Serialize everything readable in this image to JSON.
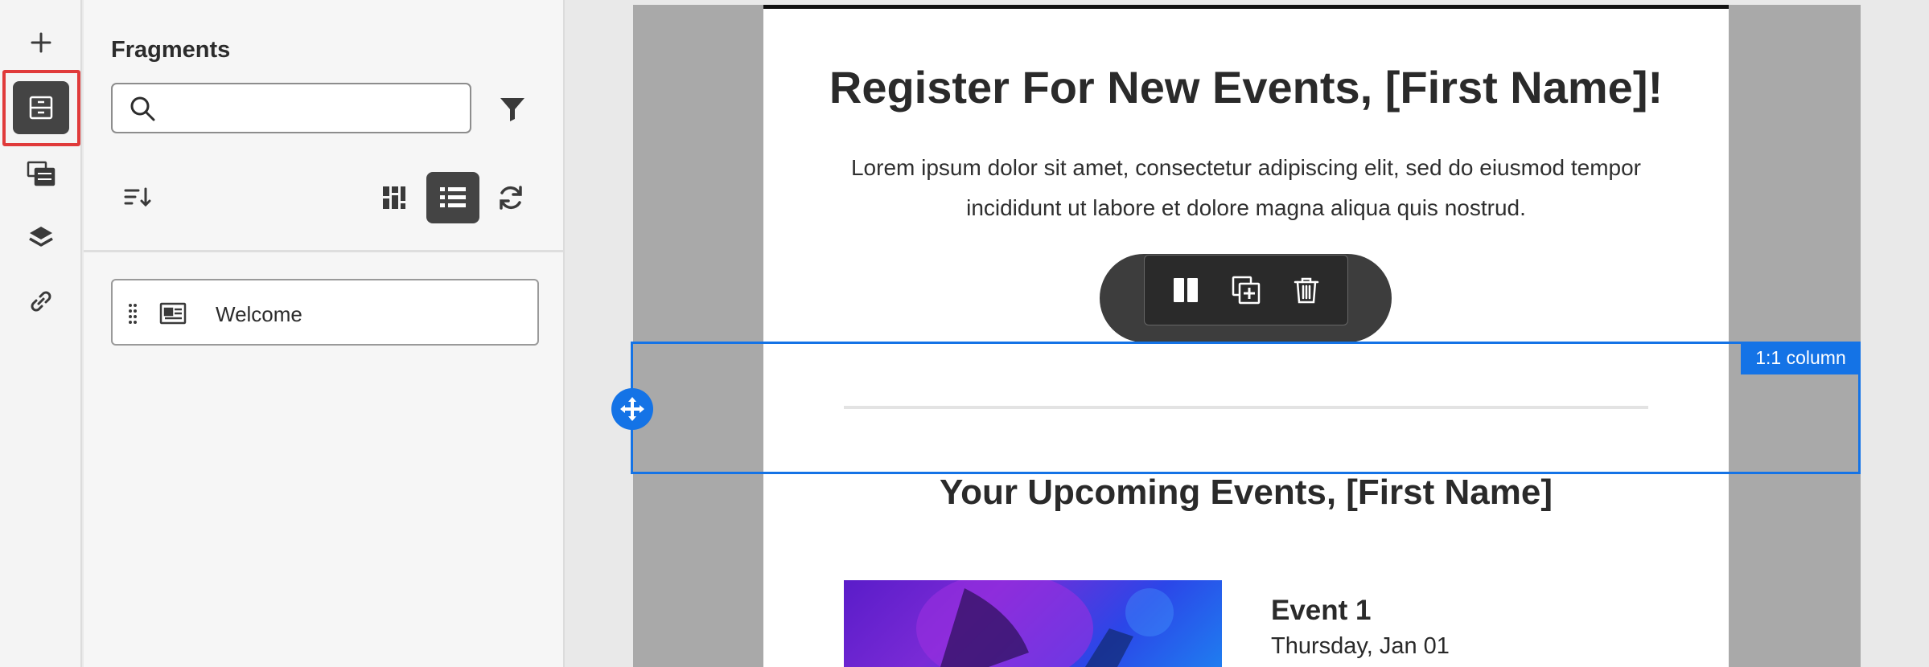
{
  "sidebar": {
    "icons": [
      "plus-icon",
      "fragments-icon",
      "assets-icon",
      "layers-icon",
      "link-icon"
    ]
  },
  "fragments_panel": {
    "title": "Fragments",
    "search_placeholder": "",
    "items": [
      {
        "label": "Welcome"
      }
    ]
  },
  "email": {
    "headline": "Register For New Events, [First Name]!",
    "body": "Lorem ipsum dolor sit amet, consectetur adipiscing elit, sed do eiusmod tempor incididunt ut labore et dolore magna aliqua quis nostrud.",
    "selection_label": "1:1 column",
    "subheadline": "Your Upcoming Events, [First Name]",
    "event": {
      "title": "Event 1",
      "date": "Thursday, Jan 01"
    }
  },
  "colors": {
    "accent": "#1473e6",
    "highlight": "#e03a3a",
    "active_button": "#444444"
  }
}
